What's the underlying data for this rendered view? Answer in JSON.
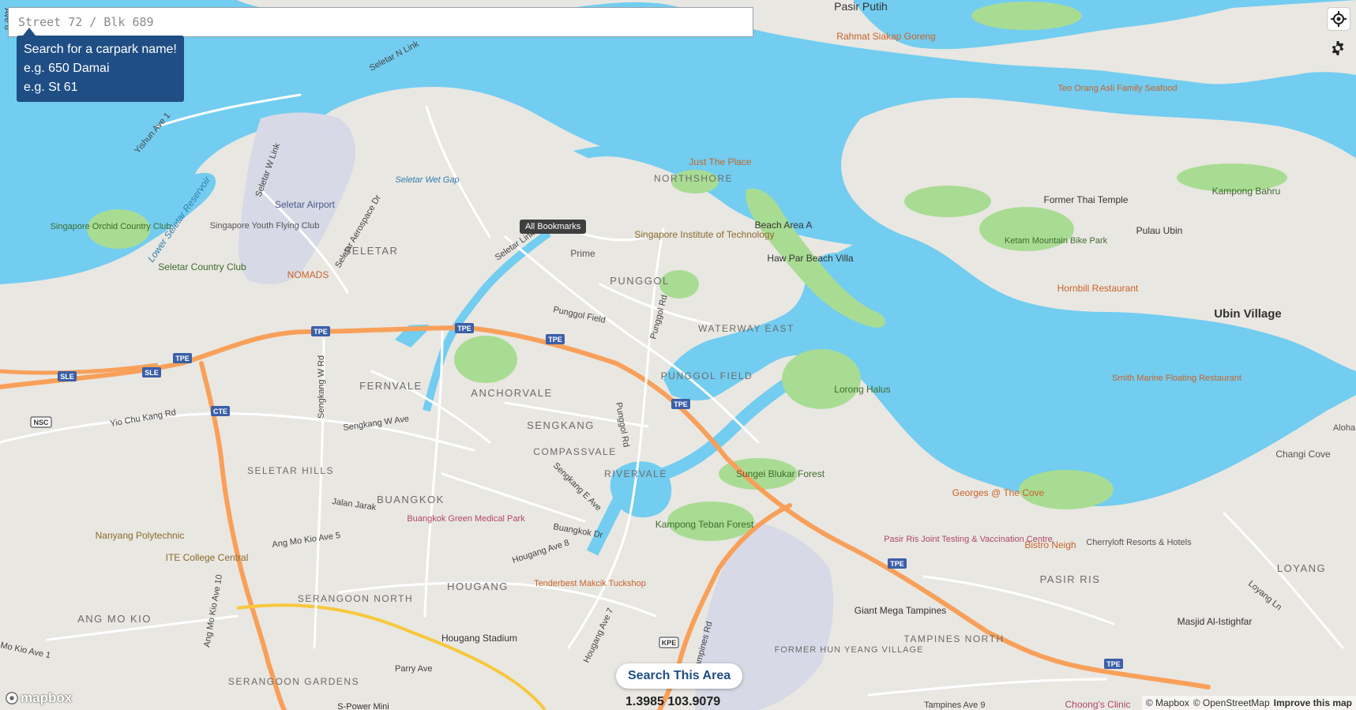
{
  "search": {
    "placeholder": "Street 72 / Blk 689"
  },
  "tooltip": {
    "lines": [
      "Search for a carpark name!",
      "e.g. 650 Damai",
      "e.g. St 61"
    ]
  },
  "controls": {
    "locate_icon": "crosshair-icon",
    "settings_icon": "gear-icon"
  },
  "bookmarks": {
    "label": "All Bookmarks"
  },
  "search_area": {
    "label": "Search This Area"
  },
  "coordinates": {
    "text": "1.3985 103.9079"
  },
  "attribution": {
    "logo": "mapbox",
    "mapbox": "© Mapbox",
    "osm": "© OpenStreetMap",
    "improve": "Improve this map"
  },
  "colors": {
    "water": "#72cdf0",
    "land": "#e9e7e2",
    "park": "#a9dc93",
    "expressway": "#f8a05a",
    "road": "#ffffff",
    "accent": "#1f4e85"
  },
  "map_labels": {
    "areas": [
      "Pasir Putih",
      "SELETAR",
      "NORTHSHORE",
      "PUNGGOL",
      "WATERWAY EAST",
      "PUNGGOL FIELD",
      "FERNVALE",
      "ANCHORVALE",
      "SENGKANG",
      "COMPASSVALE",
      "RIVERVALE",
      "BUANGKOK",
      "SELETAR HILLS",
      "HOUGANG",
      "SERANGOON NORTH",
      "ANG MO KIO",
      "SERANGOON GARDENS",
      "FORMER HUN YEANG VILLAGE",
      "TAMPINES NORTH",
      "PASIR RIS",
      "LOYANG",
      "Ubin Village",
      "Kampong Bahru",
      "Pulau Ubin"
    ],
    "pois": [
      "Rahmat Siakap Goreng",
      "Teo Orang Asli Family Seafood",
      "Just The Place",
      "Seletar Airport",
      "Singapore Youth Flying Club",
      "Seletar Country Club",
      "NOMADS",
      "Prime",
      "Singapore Institute of Technology",
      "Beach Area A",
      "Haw Par Beach Villa",
      "Former Thai Temple",
      "Ketam Mountain Bike Park",
      "Hornbill Restaurant",
      "Smith Marine Floating Restaurant",
      "Lorong Halus",
      "Sungei Blukar Forest",
      "Kampong Teban Forest",
      "Buangkok Green Medical Park",
      "Nanyang Polytechnic",
      "ITE College Central",
      "Tenderbest Makcik Tuckshop",
      "Hougang Stadium",
      "Giant Mega Tampines",
      "Pasir Ris Joint Testing & Vaccination Centre",
      "Bistro Neigh",
      "Georges @ The Cove",
      "Cherryloft Resorts & Hotels",
      "Changi Cove",
      "Masjid Al-Istighfar",
      "Choong's Clinic",
      "S-Power Mini",
      "Singapore Orchid Country Club",
      "Aloha"
    ],
    "waters": [
      "Seletar Wet Gap",
      "Lower Seletar Reservoir"
    ],
    "roads": [
      "Seletar N Link",
      "Seletar W Link",
      "Yishun Ave 1",
      "Seletar Aerospace Dr",
      "Seletar Link",
      "Punggol Field",
      "Punggol Rd",
      "Yio Chu Kang Rd",
      "Sengkang W Ave",
      "Sengkang W Rd",
      "Jalan Jarak",
      "Ang Mo Kio Ave 5",
      "Ang Mo Kio Ave 10",
      "Sengkang E Ave",
      "Buangkok Dr",
      "Hougang Ave 8",
      "Hougang Ave 7",
      "Tampines Rd",
      "Parry Ave",
      "Tampines Ave 9",
      "Loyang Ln",
      "Mo Kio Ave 1",
      "Punggol Rd",
      "Ave 8"
    ],
    "highways": [
      "TPE",
      "SLE",
      "CTE",
      "KPE",
      "NSC"
    ]
  }
}
